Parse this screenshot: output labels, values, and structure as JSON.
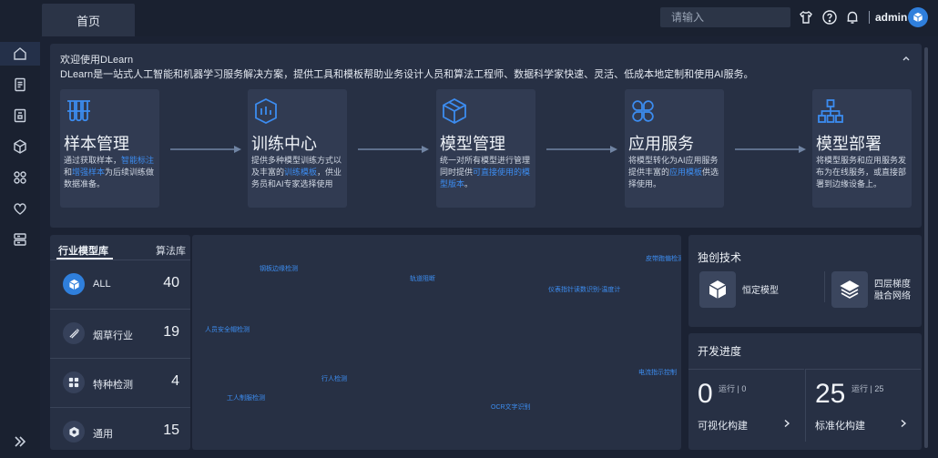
{
  "topbar": {
    "home_tab": "首页",
    "search_placeholder": "请输入",
    "username": "admin",
    "icons": [
      "shirt-icon",
      "help-icon",
      "bell-icon"
    ]
  },
  "sidebar": {
    "icons": [
      "home-icon",
      "document-icon",
      "book-icon",
      "cube-icon",
      "grid-icon",
      "heart-icon",
      "server-icon",
      "expand-icon"
    ]
  },
  "welcome": {
    "title": "欢迎使用DLearn",
    "desc": "DLearn是一站式人工智能和机器学习服务解决方案，提供工具和模板帮助业务设计人员和算法工程师、数据科学家快速、灵活、低成本地定制和使用AI服务。",
    "steps": [
      {
        "title": "样本管理",
        "desc_before": "通过获取样本，",
        "hl1": "智能标注",
        "desc_mid": "和",
        "hl2": "增强样本",
        "desc_after": "为后续训练做数据准备。"
      },
      {
        "title": "训练中心",
        "desc_before": "提供多种模型训练方式以及丰富的",
        "hl1": "训练模板",
        "desc_mid": "，供业务员和AI专家选择使用",
        "hl2": "",
        "desc_after": ""
      },
      {
        "title": "模型管理",
        "desc_before": "统一对所有模型进行管理同时提供",
        "hl1": "可直接使用的模型版本",
        "desc_mid": "。",
        "hl2": "",
        "desc_after": ""
      },
      {
        "title": "应用服务",
        "desc_before": "将模型转化为AI应用服务提供丰富的",
        "hl1": "应用模板",
        "desc_mid": "供选择使用。",
        "hl2": "",
        "desc_after": ""
      },
      {
        "title": "模型部署",
        "desc_before": "将模型服务和应用服务发布为在线服务，或直接部署到边缘设备上。",
        "hl1": "",
        "desc_mid": "",
        "hl2": "",
        "desc_after": ""
      }
    ]
  },
  "industry": {
    "tab_active": "行业模型库",
    "tab_other": "算法库",
    "rows": [
      {
        "label": "ALL",
        "count": "40"
      },
      {
        "label": "烟草行业",
        "count": "19"
      },
      {
        "label": "特种检测",
        "count": "4"
      },
      {
        "label": "通用",
        "count": "15"
      }
    ]
  },
  "tags": [
    {
      "text": "钢板边缘检测",
      "dim": false
    },
    {
      "text": "轨道阻断",
      "dim": false
    },
    {
      "text": "皮带跑偏检测",
      "dim": false
    },
    {
      "text": "仪表指针读数识别-温度计",
      "dim": false
    },
    {
      "text": "人员安全帽检测",
      "dim": false
    },
    {
      "text": "行人检测",
      "dim": false
    },
    {
      "text": "电流指示控制",
      "dim": false
    },
    {
      "text": "工人制服检测",
      "dim": false
    },
    {
      "text": "OCR文字识别",
      "dim": false
    }
  ],
  "tech": {
    "title": "独创技术",
    "item1": "恒定模型",
    "item2_line1": "四层梯度",
    "item2_line2": "融合网络"
  },
  "progress": {
    "title": "开发进度",
    "cells": [
      {
        "num": "0",
        "sub": "运行 | 0",
        "label": "可视化构建"
      },
      {
        "num": "25",
        "sub": "运行 | 25",
        "label": "标准化构建"
      }
    ]
  }
}
